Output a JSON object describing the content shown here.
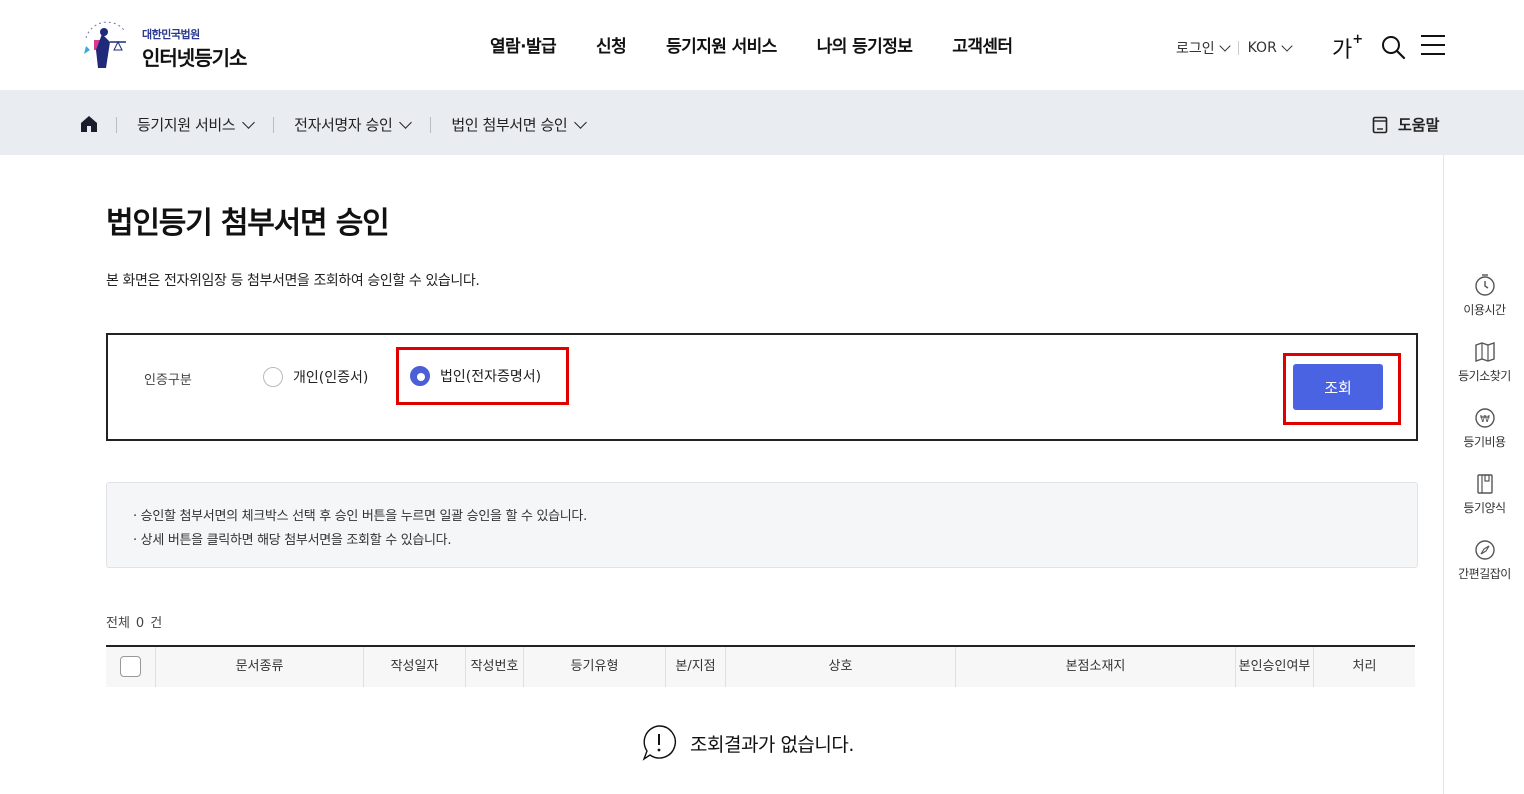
{
  "header": {
    "logo_small": "대한민국법원",
    "logo_big": "인터넷등기소",
    "nav": [
      "열람·발급",
      "신청",
      "등기지원 서비스",
      "나의 등기정보",
      "고객센터"
    ],
    "login": "로그인",
    "lang": "KOR",
    "fontsize": "가",
    "fontsize_plus": "+"
  },
  "breadcrumb": {
    "items": [
      "등기지원 서비스",
      "전자서명자 승인",
      "법인 첨부서면 승인"
    ],
    "help": "도움말"
  },
  "quick_menu": [
    {
      "label": "이용시간",
      "icon": "clock-icon"
    },
    {
      "label": "등기소찾기",
      "icon": "map-icon"
    },
    {
      "label": "등기비용",
      "icon": "won-icon"
    },
    {
      "label": "등기양식",
      "icon": "book-icon"
    },
    {
      "label": "간편길잡이",
      "icon": "compass-icon"
    }
  ],
  "main": {
    "title": "법인등기 첨부서면 승인",
    "description": "본 화면은 전자위임장 등 첨부서면을 조회하여 승인할 수 있습니다.",
    "search": {
      "label": "인증구분",
      "option_personal": "개인(인증서)",
      "option_corporate": "법인(전자증명서)",
      "selected": "법인(전자증명서)",
      "button": "조회"
    },
    "notices": [
      "· 승인할 첨부서면의 체크박스 선택 후 승인 버튼을 누르면 일괄 승인을 할 수 있습니다.",
      "· 상세 버튼을 클릭하면 해당 첨부서면을 조회할 수 있습니다."
    ],
    "total_prefix": "전체",
    "total_count": "0",
    "total_suffix": "건",
    "columns": [
      "문서종류",
      "작성일자",
      "작성번호",
      "등기유형",
      "본/지점",
      "상호",
      "본점소재지",
      "본인승인여부",
      "처리"
    ],
    "empty_message": "조회결과가 없습니다."
  },
  "colors": {
    "primary": "#4a63e3",
    "highlight": "#e00000",
    "crumb_bg": "#e9ecf1"
  }
}
